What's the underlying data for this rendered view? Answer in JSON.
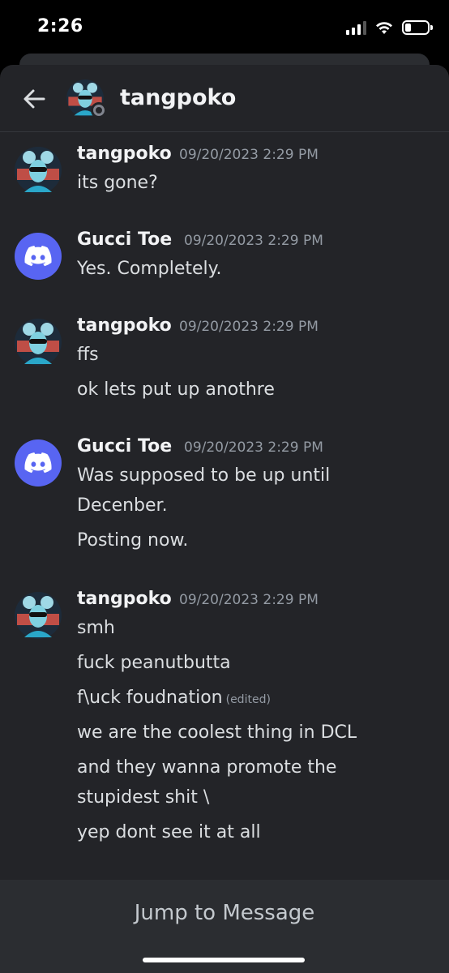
{
  "status_bar": {
    "time": "2:26"
  },
  "header": {
    "back_icon": "arrow-left-icon",
    "title": "tangpoko",
    "presence": "offline"
  },
  "messages": [
    {
      "author": "tangpoko",
      "timestamp": "09/20/2023 2:29 PM",
      "avatar": "user-avatar",
      "lines": [
        "its gone?"
      ]
    },
    {
      "author": "Gucci Toe",
      "timestamp": "09/20/2023 2:29 PM",
      "avatar": "discord-logo-icon",
      "lines": [
        "Yes. Completely."
      ]
    },
    {
      "author": "tangpoko",
      "timestamp": "09/20/2023 2:29 PM",
      "avatar": "user-avatar",
      "lines": [
        "ffs",
        "ok lets put up anothre"
      ]
    },
    {
      "author": "Gucci Toe",
      "timestamp": "09/20/2023 2:29 PM",
      "avatar": "discord-logo-icon",
      "lines": [
        "Was supposed to be up until",
        "Decenber.",
        "Posting now."
      ]
    },
    {
      "author": "tangpoko",
      "timestamp": "09/20/2023 2:29 PM",
      "avatar": "user-avatar",
      "lines": [
        "smh",
        "fuck peanutbutta",
        "f\\uck foudnation",
        "we are the coolest thing in DCL",
        "and they wanna promote the",
        "stupidest shit \\",
        "yep dont see it at all"
      ]
    }
  ],
  "edited_label": "(edited)",
  "jump_to_message": "Jump to Message",
  "colors": {
    "background": "#232428",
    "discord_blurple": "#5865f2",
    "text": "#dbdee1",
    "muted": "#949ba4"
  }
}
